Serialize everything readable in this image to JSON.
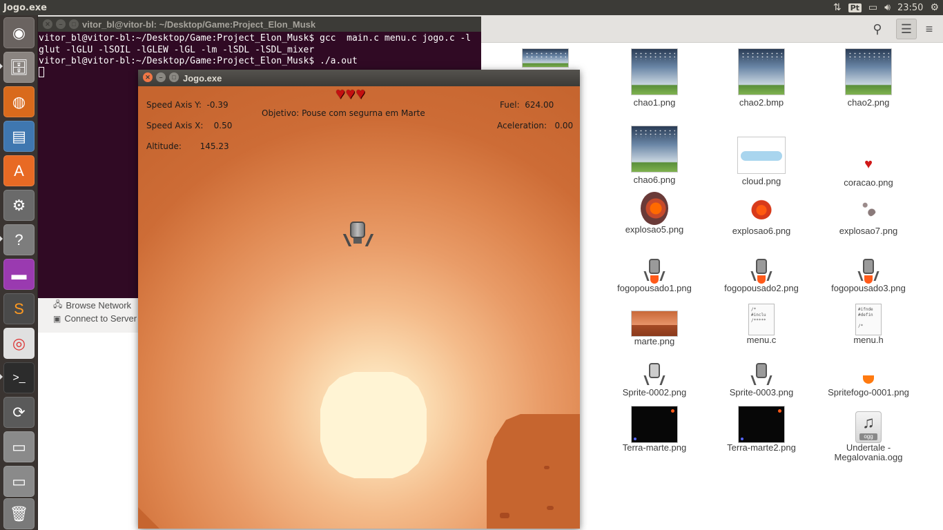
{
  "top_panel": {
    "active_app": "Jogo.exe",
    "keyboard_layout": "Pt",
    "clock": "23:50"
  },
  "launcher": {
    "items": [
      {
        "name": "ubuntu-dash",
        "icon": "ubuntu-logo-icon"
      },
      {
        "name": "files",
        "icon": "file-cabinet-icon"
      },
      {
        "name": "firefox",
        "icon": "firefox-icon"
      },
      {
        "name": "libreoffice-writer",
        "icon": "document-icon"
      },
      {
        "name": "software-center",
        "icon": "shopping-bag-icon"
      },
      {
        "name": "system-settings",
        "icon": "gear-wrench-icon"
      },
      {
        "name": "help",
        "icon": "question-icon"
      },
      {
        "name": "libreoffice-impress",
        "icon": "presentation-icon"
      },
      {
        "name": "sublime-text",
        "icon": "sublime-icon"
      },
      {
        "name": "chrome",
        "icon": "chrome-icon"
      },
      {
        "name": "terminal",
        "icon": "terminal-icon"
      },
      {
        "name": "software-updater",
        "icon": "updater-icon"
      },
      {
        "name": "drive-1",
        "icon": "drive-icon"
      },
      {
        "name": "drive-2",
        "icon": "drive-icon"
      },
      {
        "name": "trash",
        "icon": "trash-icon"
      }
    ]
  },
  "file_manager": {
    "sidebar": {
      "browse_network": "Browse Network",
      "connect_to_server": "Connect to Server"
    },
    "files": [
      {
        "name": "chao1.png"
      },
      {
        "name": "chao2.bmp"
      },
      {
        "name": "chao2.png"
      },
      {
        "name": "chao6.png"
      },
      {
        "name": "cloud.png"
      },
      {
        "name": "coracao.png"
      },
      {
        "name": "explosao5.png"
      },
      {
        "name": "explosao6.png"
      },
      {
        "name": "explosao7.png"
      },
      {
        "name": "fogopousado1.png"
      },
      {
        "name": "fogopousado2.png"
      },
      {
        "name": "fogopousado3.png"
      },
      {
        "name": "marte.png"
      },
      {
        "name": "menu.c"
      },
      {
        "name": "menu.h"
      },
      {
        "name": "Sprite-0002.png"
      },
      {
        "name": "Sprite-0003.png"
      },
      {
        "name": "Spritefogo-0001.png"
      },
      {
        "name": "Terra-marte.png"
      },
      {
        "name": "Terra-marte2.png"
      },
      {
        "name": "Undertale - Megalovania.ogg"
      }
    ],
    "partial_label": "ng",
    "menu_c_preview": "/*\n#inclu\n/*****",
    "menu_h_preview": "#ifnde\n#defin\n\n/*",
    "ogg_tag": "ogg"
  },
  "terminal": {
    "title": "vitor_bl@vitor-bl: ~/Desktop/Game:Project_Elon_Musk",
    "lines": [
      "vitor_bl@vitor-bl:~/Desktop/Game:Project_Elon_Musk$ gcc  main.c menu.c jogo.c -l",
      "glut -lGLU -lSOIL -lGLEW -lGL -lm -lSDL -lSDL_mixer",
      "vitor_bl@vitor-bl:~/Desktop/Game:Project_Elon_Musk$ ./a.out"
    ]
  },
  "game": {
    "title": "Jogo.exe",
    "lives": 3,
    "speed_y": "Speed Axis Y:  -0.39",
    "speed_x": "Speed Axis X:    0.50",
    "altitude": "Altitude:       145.23",
    "objective": "Objetivo: Pouse com segurna em Marte",
    "fuel": "Fuel:  624.00",
    "acceleration": "Aceleration:   0.00",
    "colors": {
      "sky": "#c6652f",
      "sun": "#fff4d4",
      "heart": "#c41010"
    }
  }
}
